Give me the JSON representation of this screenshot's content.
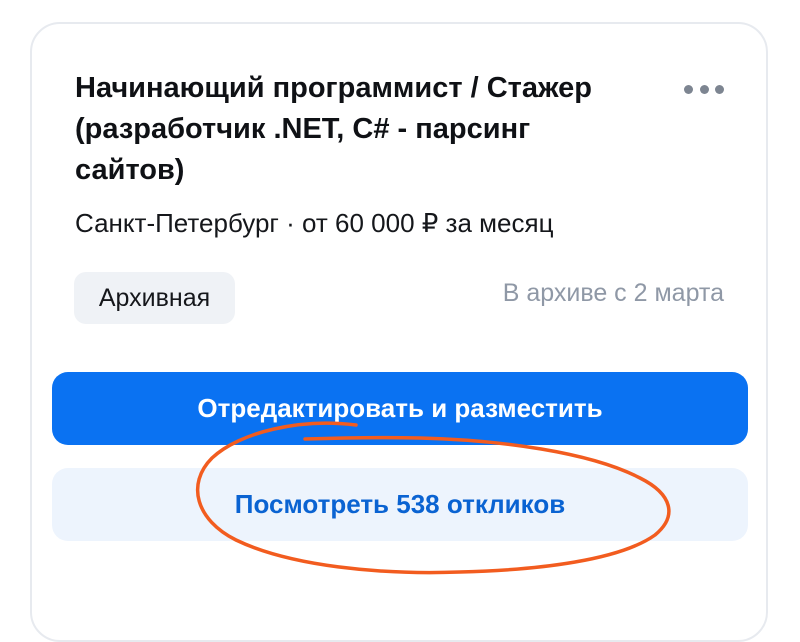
{
  "vacancy": {
    "title": "Начинающий программист / Стажер (разработчик .NET, C# - парсинг сайтов)",
    "subtitle": "Санкт-Петербург · от 60 000 ₽ за месяц",
    "status_badge": "Архивная",
    "archived_since": "В архиве с 2 марта",
    "more_icon": "more-horizontal-icon"
  },
  "actions": {
    "edit_publish_label": "Отредактировать и разместить",
    "view_responses_label": "Посмотреть 538 откликов"
  },
  "colors": {
    "primary": "#0a72f2",
    "secondary_bg": "#edf4fd",
    "secondary_text": "#0a63d2",
    "muted_text": "#8f98a6",
    "annotation": "#f25c1f"
  }
}
